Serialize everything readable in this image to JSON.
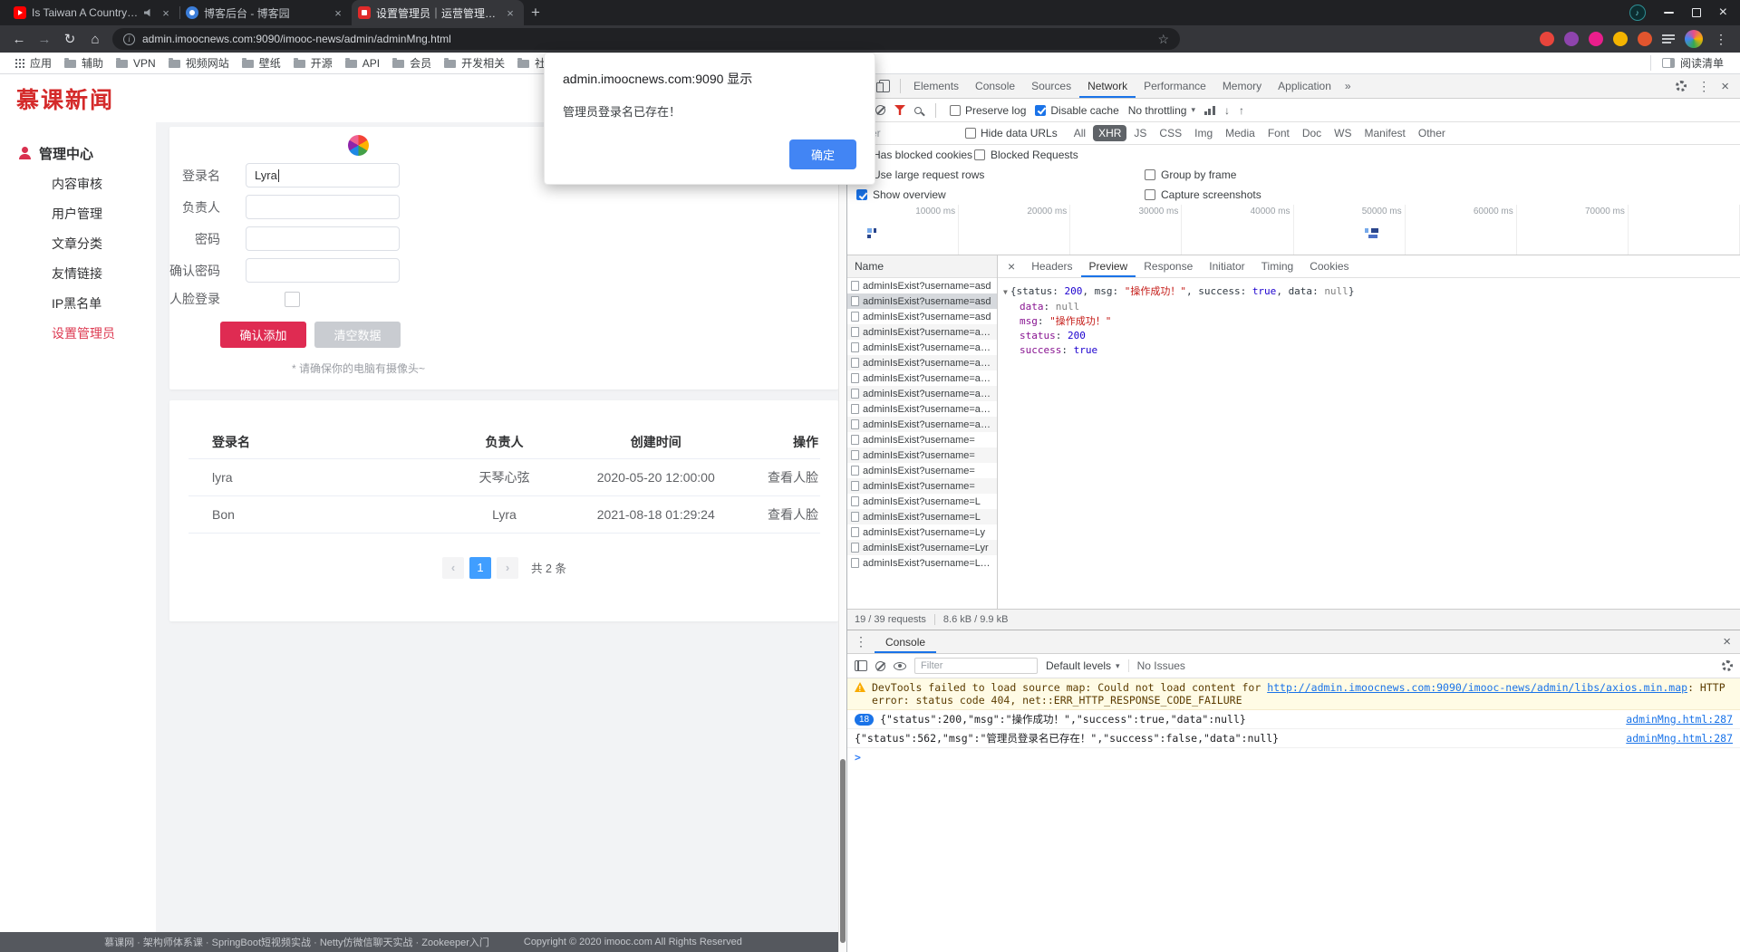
{
  "colors": {
    "accent_blue": "#1a73e8",
    "brand_red": "#d42a2a",
    "primary_button_red": "#df2b52",
    "pagination_active_blue": "#409eff",
    "dialog_button_blue": "#4285f4",
    "filter_funnel_red": "#d93025",
    "warning_bg": "#fffbe5"
  },
  "icons": {
    "record-icon": "filled red circle",
    "clear-icon": "circle with slash",
    "filter-funnel-icon": "red funnel",
    "search-icon": "magnifier",
    "gear-icon": "dotted circle gear",
    "warning-icon": "amber triangle with !",
    "folder-icon": "gray folder",
    "apps-grid-icon": "3x3 dot grid",
    "person-icon": "red user silhouette",
    "speaker-icon": "tab audio speaker",
    "expand-triangle-icon": "▼"
  },
  "browser": {
    "tabs": [
      {
        "title": "Is Taiwan A Country O...",
        "favicon": "youtube",
        "audio": true,
        "active": false
      },
      {
        "title": "博客后台 - 博客园",
        "favicon": "cnblogs",
        "audio": false,
        "active": false
      },
      {
        "title": "设置管理员｜运营管理平...",
        "favicon": "imooc",
        "audio": false,
        "active": true
      }
    ],
    "url": "admin.imoocnews.com:9090/imooc-news/admin/adminMng.html",
    "bookmarks": [
      "应用",
      "辅助",
      "VPN",
      "视频网站",
      "壁纸",
      "开源",
      "API",
      "会员",
      "开发相关",
      "社..."
    ],
    "reading_list": "阅读清单"
  },
  "dialog": {
    "title": "admin.imoocnews.com:9090 显示",
    "message": "管理员登录名已存在！",
    "ok_label": "确定"
  },
  "page": {
    "logo": "慕课新闻",
    "sidebar": {
      "header": "管理中心",
      "items": [
        "内容审核",
        "用户管理",
        "文章分类",
        "友情链接",
        "IP黑名单",
        "设置管理员"
      ],
      "active_index": 5
    },
    "form": {
      "fields": [
        {
          "label": "登录名",
          "value": "Lyra",
          "focused": true,
          "name": "login-name-input"
        },
        {
          "label": "负责人",
          "value": "",
          "focused": false,
          "name": "manager-input"
        },
        {
          "label": "密码",
          "value": "",
          "focused": false,
          "name": "password-input"
        },
        {
          "label": "确认密码",
          "value": "",
          "focused": false,
          "name": "confirm-password-input"
        }
      ],
      "face_label": "人脸登录",
      "confirm_label": "确认添加",
      "clear_label": "清空数据",
      "note": "* 请确保你的电脑有摄像头~"
    },
    "table": {
      "headers": [
        "登录名",
        "负责人",
        "创建时间",
        "操作"
      ],
      "rows": [
        {
          "username": "lyra",
          "manager": "天琴心弦",
          "created": "2020-05-20 12:00:00",
          "action": "查看人脸"
        },
        {
          "username": "Bon",
          "manager": "Lyra",
          "created": "2021-08-18 01:29:24",
          "action": "查看人脸"
        }
      ],
      "pagination": {
        "current": "1",
        "total": "共 2 条"
      }
    },
    "footer": {
      "links": "慕课网 · 架构师体系课 · SpringBoot短视频实战 · Netty仿微信聊天实战 · Zookeeper入门",
      "copyright": "Copyright © 2020 imooc.com All Rights Reserved"
    }
  },
  "devtools": {
    "tabs": [
      "Elements",
      "Console",
      "Sources",
      "Network",
      "Performance",
      "Memory",
      "Application"
    ],
    "active_tab": "Network",
    "network": {
      "preserve_log": "Preserve log",
      "disable_cache": "Disable cache",
      "throttling": "No throttling",
      "filter_placeholder": "Filter",
      "hide_data_urls": "Hide data URLs",
      "types": [
        "All",
        "XHR",
        "JS",
        "CSS",
        "Img",
        "Media",
        "Font",
        "Doc",
        "WS",
        "Manifest",
        "Other"
      ],
      "active_type": "XHR",
      "blocked_cookies": "Has blocked cookies",
      "blocked_requests": "Blocked Requests",
      "large_rows": "Use large request rows",
      "group_by_frame": "Group by frame",
      "show_overview": "Show overview",
      "capture_screenshots": "Capture screenshots",
      "timeline_ticks": [
        "10000 ms",
        "20000 ms",
        "30000 ms",
        "40000 ms",
        "50000 ms",
        "60000 ms",
        "70000 ms"
      ],
      "name_header": "Name",
      "requests": [
        "adminIsExist?username=asd",
        "adminIsExist?username=asd",
        "adminIsExist?username=asd",
        "adminIsExist?username=asdsd",
        "adminIsExist?username=asdsd",
        "adminIsExist?username=asdsd",
        "adminIsExist?username=asdsd",
        "adminIsExist?username=asdsd",
        "adminIsExist?username=asdsd",
        "adminIsExist?username=asdsd",
        "adminIsExist?username=",
        "adminIsExist?username=",
        "adminIsExist?username=",
        "adminIsExist?username=",
        "adminIsExist?username=L",
        "adminIsExist?username=L",
        "adminIsExist?username=Ly",
        "adminIsExist?username=Lyr",
        "adminIsExist?username=Lyra"
      ],
      "selected_index": 1,
      "detail_tabs": [
        "Headers",
        "Preview",
        "Response",
        "Initiator",
        "Timing",
        "Cookies"
      ],
      "active_detail_tab": "Preview",
      "preview_summary": [
        {
          "text": "{",
          "type": "plain"
        },
        {
          "text": "status",
          "type": "plain"
        },
        {
          "text": ": ",
          "type": "plain"
        },
        {
          "text": "200",
          "type": "number"
        },
        {
          "text": ", ",
          "type": "plain"
        },
        {
          "text": "msg",
          "type": "plain"
        },
        {
          "text": ": ",
          "type": "plain"
        },
        {
          "text": "\"操作成功！\"",
          "type": "string"
        },
        {
          "text": ", ",
          "type": "plain"
        },
        {
          "text": "success",
          "type": "plain"
        },
        {
          "text": ": ",
          "type": "plain"
        },
        {
          "text": "true",
          "type": "boolean"
        },
        {
          "text": ", ",
          "type": "plain"
        },
        {
          "text": "data",
          "type": "plain"
        },
        {
          "text": ": ",
          "type": "plain"
        },
        {
          "text": "null",
          "type": "null"
        },
        {
          "text": "}",
          "type": "plain"
        }
      ],
      "preview_props": [
        {
          "key": "data",
          "value": "null",
          "type": "null"
        },
        {
          "key": "msg",
          "value": "\"操作成功！\"",
          "type": "string"
        },
        {
          "key": "status",
          "value": "200",
          "type": "number"
        },
        {
          "key": "success",
          "value": "true",
          "type": "boolean"
        }
      ],
      "requests_summary": "19 / 39 requests",
      "transfer_summary": "8.6 kB / 9.9 kB"
    },
    "console": {
      "title": "Console",
      "filter_placeholder": "Filter",
      "levels_label": "Default levels",
      "issues_label": "No Issues",
      "messages": [
        {
          "type": "warning",
          "parts": [
            {
              "text": "DevTools failed to load source map: Could not load content for "
            },
            {
              "text": "http://admin.imoocnews.com:9090/imooc-news/admin/libs/axios.min.map",
              "link": true
            },
            {
              "text": ": HTTP error: status code 404, net::ERR_HTTP_RESPONSE_CODE_FAILURE"
            }
          ]
        },
        {
          "type": "log",
          "badge": "18",
          "text": "{\"status\":200,\"msg\":\"操作成功！\",\"success\":true,\"data\":null}",
          "source": "adminMng.html:287"
        },
        {
          "type": "log",
          "badge": "",
          "text": "{\"status\":562,\"msg\":\"管理员登录名已存在！\",\"success\":false,\"data\":null}",
          "source": "adminMng.html:287"
        }
      ]
    }
  }
}
